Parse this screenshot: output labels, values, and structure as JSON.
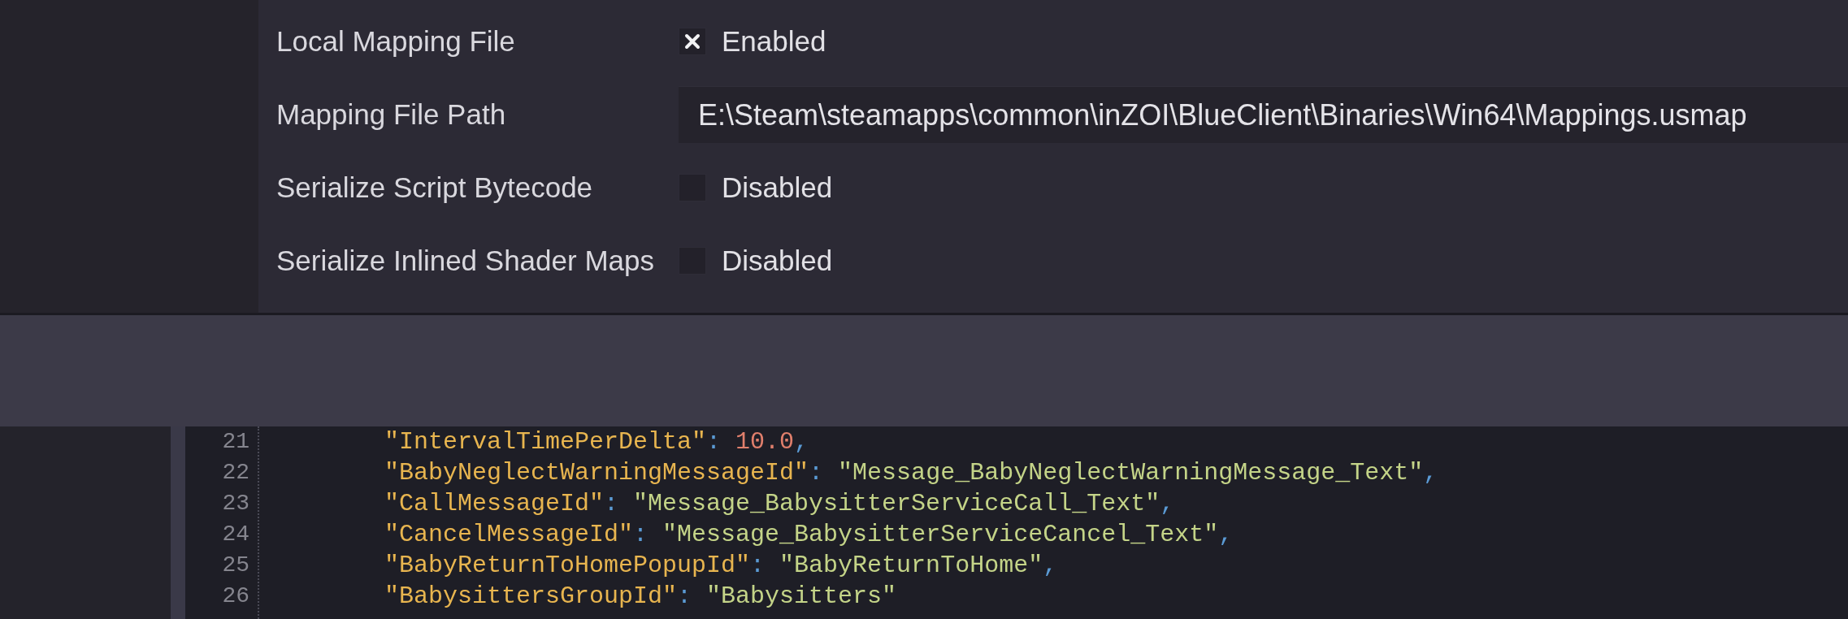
{
  "settings": [
    {
      "label": "Local Mapping File",
      "kind": "checkbox",
      "checked": true,
      "value": "Enabled"
    },
    {
      "label": "Mapping File Path",
      "kind": "path",
      "value": "E:\\Steam\\steamapps\\common\\inZOI\\BlueClient\\Binaries\\Win64\\Mappings.usmap"
    },
    {
      "label": "Serialize Script Bytecode",
      "kind": "checkbox",
      "checked": false,
      "value": "Disabled"
    },
    {
      "label": "Serialize Inlined Shader Maps",
      "kind": "checkbox",
      "checked": false,
      "value": "Disabled"
    }
  ],
  "editor": {
    "lines": [
      {
        "number": "21",
        "tokens": [
          {
            "kind": "key",
            "text": "\"IntervalTimePerDelta\""
          },
          {
            "kind": "punct",
            "text": ": "
          },
          {
            "kind": "number",
            "text": "10.0"
          },
          {
            "kind": "punct",
            "text": ","
          }
        ]
      },
      {
        "number": "22",
        "tokens": [
          {
            "kind": "key",
            "text": "\"BabyNeglectWarningMessageId\""
          },
          {
            "kind": "punct",
            "text": ": "
          },
          {
            "kind": "string",
            "text": "\"Message_BabyNeglectWarningMessage_Text\""
          },
          {
            "kind": "punct",
            "text": ","
          }
        ]
      },
      {
        "number": "23",
        "tokens": [
          {
            "kind": "key",
            "text": "\"CallMessageId\""
          },
          {
            "kind": "punct",
            "text": ": "
          },
          {
            "kind": "string",
            "text": "\"Message_BabysitterServiceCall_Text\""
          },
          {
            "kind": "punct",
            "text": ","
          }
        ]
      },
      {
        "number": "24",
        "tokens": [
          {
            "kind": "key",
            "text": "\"CancelMessageId\""
          },
          {
            "kind": "punct",
            "text": ": "
          },
          {
            "kind": "string",
            "text": "\"Message_BabysitterServiceCancel_Text\""
          },
          {
            "kind": "punct",
            "text": ","
          }
        ]
      },
      {
        "number": "25",
        "tokens": [
          {
            "kind": "key",
            "text": "\"BabyReturnToHomePopupId\""
          },
          {
            "kind": "punct",
            "text": ": "
          },
          {
            "kind": "string",
            "text": "\"BabyReturnToHome\""
          },
          {
            "kind": "punct",
            "text": ","
          }
        ]
      },
      {
        "number": "26",
        "tokens": [
          {
            "kind": "key",
            "text": "\"BabysittersGroupId\""
          },
          {
            "kind": "punct",
            "text": ": "
          },
          {
            "kind": "string",
            "text": "\"Babysitters\""
          }
        ]
      }
    ]
  }
}
